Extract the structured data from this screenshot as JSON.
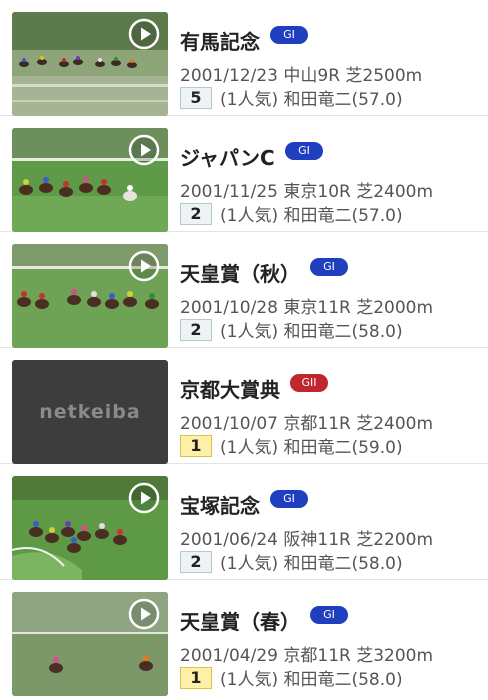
{
  "races": [
    {
      "name": "有馬記念",
      "grade": "GI",
      "grade_color": "#1f3fbf",
      "info": "2001/12/23 中山9R 芝2500m",
      "rank": "5",
      "result": "(1人気) 和田竜二(57.0)",
      "thumbnail": "race-video",
      "has_play": true
    },
    {
      "name": "ジャパンC",
      "grade": "GI",
      "grade_color": "#1f3fbf",
      "info": "2001/11/25 東京10R 芝2400m",
      "rank": "2",
      "result": "(1人気) 和田竜二(57.0)",
      "thumbnail": "race-video",
      "has_play": true
    },
    {
      "name": "天皇賞（秋）",
      "grade": "GI",
      "grade_color": "#1f3fbf",
      "info": "2001/10/28 東京11R 芝2000m",
      "rank": "2",
      "result": "(1人気) 和田竜二(58.0)",
      "thumbnail": "race-video",
      "has_play": true
    },
    {
      "name": "京都大賞典",
      "grade": "GII",
      "grade_color": "#c0272d",
      "info": "2001/10/07 京都11R 芝2400m",
      "rank": "1",
      "result": "(1人気) 和田竜二(59.0)",
      "thumbnail": "netkeiba-logo",
      "logo_text": "netkeiba",
      "has_play": false
    },
    {
      "name": "宝塚記念",
      "grade": "GI",
      "grade_color": "#1f3fbf",
      "info": "2001/06/24 阪神11R 芝2200m",
      "rank": "2",
      "result": "(1人気) 和田竜二(58.0)",
      "thumbnail": "race-video",
      "has_play": true
    },
    {
      "name": "天皇賞（春）",
      "grade": "GI",
      "grade_color": "#1f3fbf",
      "info": "2001/04/29 京都11R 芝3200m",
      "rank": "1",
      "result": "(1人気) 和田竜二(58.0)",
      "thumbnail": "race-video",
      "has_play": true
    }
  ]
}
